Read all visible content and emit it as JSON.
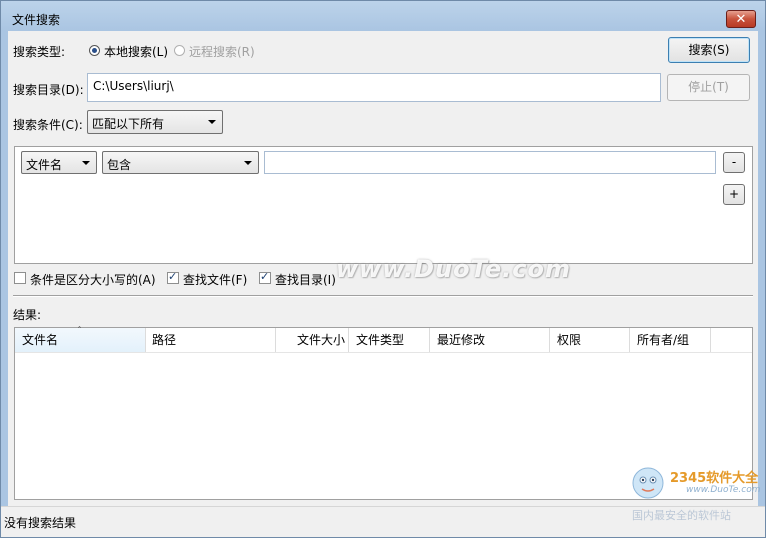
{
  "window": {
    "title": "文件搜索",
    "close_glyph": "✕"
  },
  "search_type": {
    "label": "搜索类型:",
    "local": "本地搜索(L)",
    "remote": "远程搜索(R)",
    "selected": "local"
  },
  "directory": {
    "label": "搜索目录(D):",
    "value": "C:\\Users\\liurj\\"
  },
  "condition": {
    "label": "搜索条件(C):",
    "selected": "匹配以下所有"
  },
  "buttons": {
    "search": "搜索(S)",
    "stop": "停止(T)",
    "remove": "-",
    "add": "+"
  },
  "criteria": [
    {
      "field": "文件名",
      "operator": "包含",
      "value": ""
    }
  ],
  "options": {
    "case_sensitive": {
      "label": "条件是区分大小写的(A)",
      "checked": false
    },
    "find_files": {
      "label": "查找文件(F)",
      "checked": true
    },
    "find_dirs": {
      "label": "查找目录(I)",
      "checked": true
    }
  },
  "results": {
    "label": "结果:",
    "columns": [
      "文件名",
      "路径",
      "文件大小",
      "文件类型",
      "最近修改",
      "权限",
      "所有者/组"
    ],
    "sort_column": "文件名",
    "sort_glyph": "ˆ",
    "rows": []
  },
  "status": "没有搜索结果",
  "watermark": {
    "text": "www.DuoTe.com",
    "logo_brand": "2345软件大全",
    "logo_url": "www.DuoTe.com",
    "logo_slogan": "国内最安全的软件站"
  }
}
